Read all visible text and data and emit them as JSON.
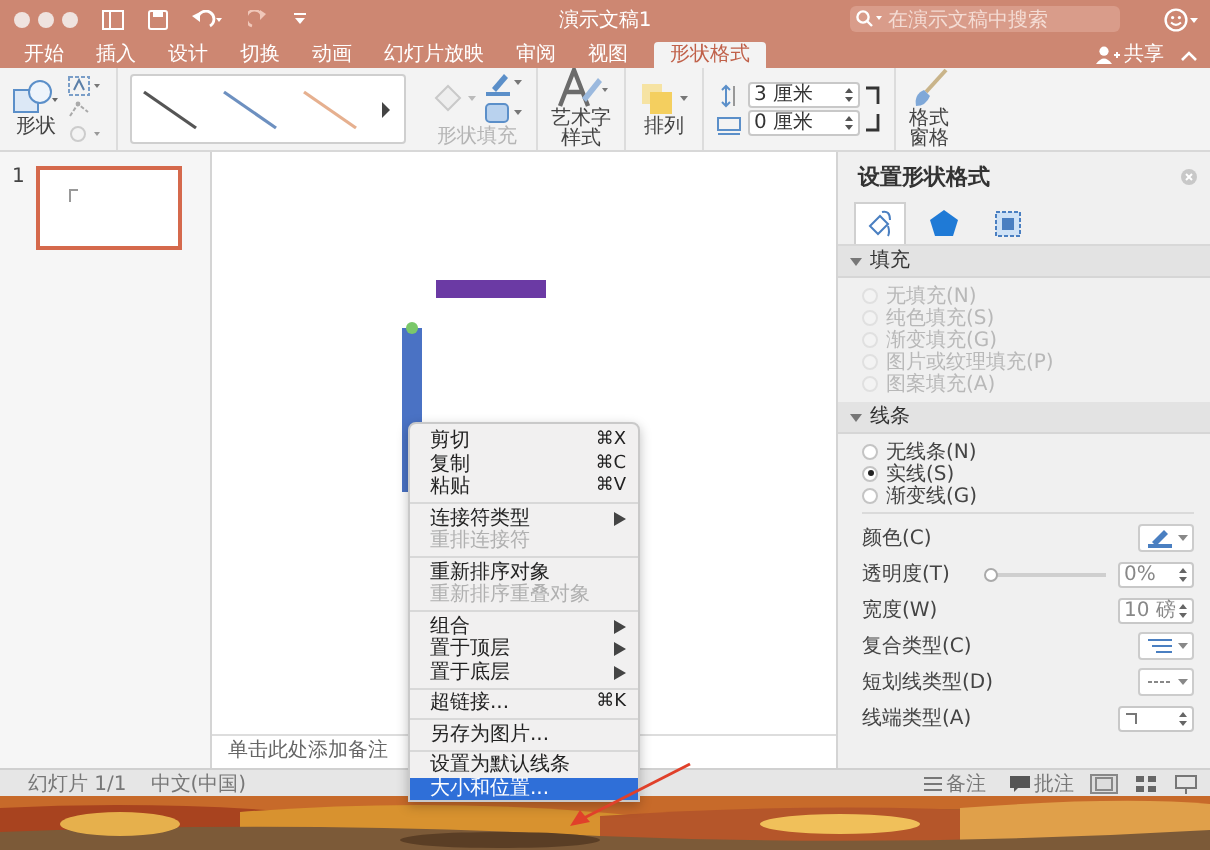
{
  "window": {
    "title": "演示文稿1",
    "search_placeholder": "在演示文稿中搜索"
  },
  "tabs": [
    {
      "label": "开始",
      "selected": false
    },
    {
      "label": "插入",
      "selected": false
    },
    {
      "label": "设计",
      "selected": false
    },
    {
      "label": "切换",
      "selected": false
    },
    {
      "label": "动画",
      "selected": false
    },
    {
      "label": "幻灯片放映",
      "selected": false
    },
    {
      "label": "审阅",
      "selected": false
    },
    {
      "label": "视图",
      "selected": false
    },
    {
      "label": "形状格式",
      "selected": true
    }
  ],
  "share": "共享",
  "ribbon": {
    "shapes": "形状",
    "shape_fill": {
      "label": "形状填充",
      "disabled": true
    },
    "wordart": "艺术字样式",
    "arrange": "排列",
    "height": "3 厘米",
    "width": "0 厘米",
    "format_pane": "格式窗格"
  },
  "slides": [
    {
      "number": "1",
      "selected": true
    }
  ],
  "notes_placeholder": "单击此处添加备注",
  "format_pane": {
    "title": "设置形状格式",
    "tabs": [
      {
        "selected": true
      },
      {
        "selected": false
      },
      {
        "selected": false
      }
    ],
    "sections": [
      {
        "title": "填充",
        "expanded": true,
        "options": [
          {
            "label": "无填充(N)",
            "selected": false,
            "disabled": true
          },
          {
            "label": "纯色填充(S)",
            "selected": false,
            "disabled": true
          },
          {
            "label": "渐变填充(G)",
            "selected": false,
            "disabled": true
          },
          {
            "label": "图片或纹理填充(P)",
            "selected": false,
            "disabled": true
          },
          {
            "label": "图案填充(A)",
            "selected": false,
            "disabled": true
          }
        ]
      },
      {
        "title": "线条",
        "expanded": true,
        "options": [
          {
            "label": "无线条(N)",
            "selected": false,
            "disabled": false
          },
          {
            "label": "实线(S)",
            "selected": true,
            "disabled": false
          },
          {
            "label": "渐变线(G)",
            "selected": false,
            "disabled": false
          }
        ],
        "properties": [
          {
            "kind": "color",
            "label": "颜色(C)"
          },
          {
            "kind": "slider",
            "label": "透明度(T)",
            "level": 0,
            "value": "0%"
          },
          {
            "kind": "spinner",
            "label": "宽度(W)",
            "value": "10 磅"
          },
          {
            "kind": "compound",
            "label": "复合类型(C)"
          },
          {
            "kind": "dash",
            "label": "短划线类型(D)"
          },
          {
            "kind": "cap",
            "label": "线端类型(A)"
          }
        ]
      }
    ]
  },
  "status_bar": {
    "slide": "幻灯片 1/1",
    "language": "中文(中国)",
    "notes": "备注",
    "comments": "批注"
  },
  "context_menu": {
    "groups": [
      [
        {
          "label": "剪切",
          "shortcut": "⌘X",
          "submenu": false,
          "disabled": false,
          "selected": false
        },
        {
          "label": "复制",
          "shortcut": "⌘C",
          "submenu": false,
          "disabled": false,
          "selected": false
        },
        {
          "label": "粘贴",
          "shortcut": "⌘V",
          "submenu": false,
          "disabled": false,
          "selected": false
        }
      ],
      [
        {
          "label": "连接符类型",
          "submenu": true,
          "disabled": false,
          "selected": false
        },
        {
          "label": "重排连接符",
          "submenu": false,
          "disabled": true,
          "selected": false
        }
      ],
      [
        {
          "label": "重新排序对象",
          "submenu": false,
          "disabled": false,
          "selected": false
        },
        {
          "label": "重新排序重叠对象",
          "submenu": false,
          "disabled": true,
          "selected": false
        }
      ],
      [
        {
          "label": "组合",
          "submenu": true,
          "disabled": false,
          "selected": false
        },
        {
          "label": "置于顶层",
          "submenu": true,
          "disabled": false,
          "selected": false
        },
        {
          "label": "置于底层",
          "submenu": true,
          "disabled": false,
          "selected": false
        }
      ],
      [
        {
          "label": "超链接...",
          "shortcut": "⌘K",
          "submenu": false,
          "disabled": false,
          "selected": false
        }
      ],
      [
        {
          "label": "另存为图片...",
          "submenu": false,
          "disabled": false,
          "selected": false
        }
      ],
      [
        {
          "label": "设置为默认线条",
          "submenu": false,
          "disabled": false,
          "selected": false
        },
        {
          "label": "大小和位置...",
          "submenu": false,
          "disabled": false,
          "selected": true
        }
      ]
    ]
  }
}
